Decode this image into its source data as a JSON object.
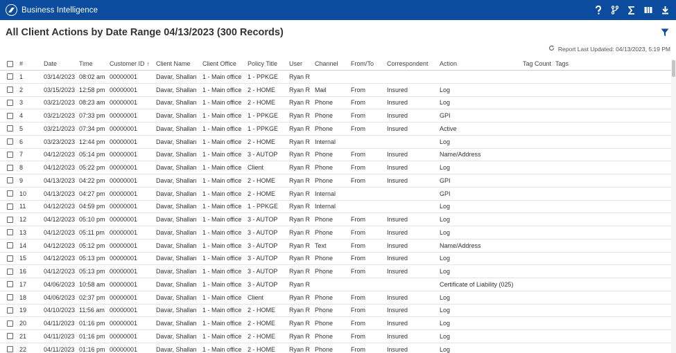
{
  "app": {
    "title": "Business Intelligence"
  },
  "header": {
    "title": "All Client Actions by Date Range 04/13/2023 (300 Records)"
  },
  "report": {
    "last_updated": "Report Last Updated: 04/13/2023, 5:19 PM"
  },
  "columns": [
    "#",
    "Date",
    "Time",
    "Customer ID",
    "Client Name",
    "Client Office",
    "Policy Title",
    "User",
    "Channel",
    "From/To",
    "Correspondent",
    "Action",
    "Tag Count",
    "Tags"
  ],
  "rows": [
    [
      "1",
      "03/14/2023",
      "08:02 am",
      "00000001",
      "Davar, Shallan",
      "1 - Main office",
      "1 - PPKGE",
      "Ryan R",
      "",
      "",
      "",
      "",
      "",
      ""
    ],
    [
      "2",
      "03/15/2023",
      "12:58 pm",
      "00000001",
      "Davar, Shallan",
      "1 - Main office",
      "2 - HOME",
      "Ryan R",
      "Mail",
      "From",
      "Insured",
      "Log",
      "",
      ""
    ],
    [
      "3",
      "03/21/2023",
      "08:23 am",
      "00000001",
      "Davar, Shallan",
      "1 - Main office",
      "2 - HOME",
      "Ryan R",
      "Phone",
      "From",
      "Insured",
      "Log",
      "",
      ""
    ],
    [
      "4",
      "03/21/2023",
      "07:33 pm",
      "00000001",
      "Davar, Shallan",
      "1 - Main office",
      "1 - PPKGE",
      "Ryan R",
      "Phone",
      "From",
      "Insured",
      "GPI",
      "",
      ""
    ],
    [
      "5",
      "03/21/2023",
      "07:34 pm",
      "00000001",
      "Davar, Shallan",
      "1 - Main office",
      "1 - PPKGE",
      "Ryan R",
      "Phone",
      "From",
      "Insured",
      "Active",
      "",
      ""
    ],
    [
      "6",
      "03/23/2023",
      "12:44 pm",
      "00000001",
      "Davar, Shallan",
      "1 - Main office",
      "2 - HOME",
      "Ryan R",
      "Internal",
      "",
      "",
      "Log",
      "",
      ""
    ],
    [
      "7",
      "04/12/2023",
      "05:14 pm",
      "00000001",
      "Davar, Shallan",
      "1 - Main office",
      "3 - AUTOP",
      "Ryan R",
      "Phone",
      "From",
      "Insured",
      "Name/Address",
      "",
      ""
    ],
    [
      "8",
      "04/12/2023",
      "05:22 pm",
      "00000001",
      "Davar, Shallan",
      "1 - Main office",
      "Client",
      "Ryan R",
      "Phone",
      "From",
      "Insured",
      "Log",
      "",
      ""
    ],
    [
      "9",
      "04/13/2023",
      "04:22 pm",
      "00000001",
      "Davar, Shallan",
      "1 - Main office",
      "2 - HOME",
      "Ryan R",
      "Phone",
      "From",
      "Insured",
      "GPI",
      "",
      ""
    ],
    [
      "10",
      "04/13/2023",
      "04:27 pm",
      "00000001",
      "Davar, Shallan",
      "1 - Main office",
      "2 - HOME",
      "Ryan R",
      "Internal",
      "",
      "",
      "GPI",
      "",
      ""
    ],
    [
      "11",
      "04/12/2023",
      "04:59 pm",
      "00000001",
      "Davar, Shallan",
      "1 - Main office",
      "1 - PPKGE",
      "Ryan R",
      "Internal",
      "",
      "",
      "Log",
      "",
      ""
    ],
    [
      "12",
      "04/12/2023",
      "05:10 pm",
      "00000001",
      "Davar, Shallan",
      "1 - Main office",
      "3 - AUTOP",
      "Ryan R",
      "Phone",
      "From",
      "Insured",
      "Log",
      "",
      ""
    ],
    [
      "13",
      "04/12/2023",
      "05:11 pm",
      "00000001",
      "Davar, Shallan",
      "1 - Main office",
      "3 - AUTOP",
      "Ryan R",
      "Phone",
      "From",
      "Insured",
      "Log",
      "",
      ""
    ],
    [
      "14",
      "04/12/2023",
      "05:12 pm",
      "00000001",
      "Davar, Shallan",
      "1 - Main office",
      "3 - AUTOP",
      "Ryan R",
      "Text",
      "From",
      "Insured",
      "Name/Address",
      "",
      ""
    ],
    [
      "15",
      "04/12/2023",
      "05:13 pm",
      "00000001",
      "Davar, Shallan",
      "1 - Main office",
      "3 - AUTOP",
      "Ryan R",
      "Phone",
      "From",
      "Insured",
      "Log",
      "",
      ""
    ],
    [
      "16",
      "04/12/2023",
      "05:13 pm",
      "00000001",
      "Davar, Shallan",
      "1 - Main office",
      "3 - AUTOP",
      "Ryan R",
      "Phone",
      "From",
      "Insured",
      "Log",
      "",
      ""
    ],
    [
      "17",
      "04/06/2023",
      "10:58 am",
      "00000001",
      "Davar, Shallan",
      "1 - Main office",
      "3 - AUTOP",
      "Ryan R",
      "",
      "",
      "",
      "Certificate of Liability (025)",
      "",
      ""
    ],
    [
      "18",
      "04/06/2023",
      "02:37 pm",
      "00000001",
      "Davar, Shallan",
      "1 - Main office",
      "Client",
      "Ryan R",
      "Phone",
      "From",
      "Insured",
      "Log",
      "",
      ""
    ],
    [
      "19",
      "04/10/2023",
      "11:56 am",
      "00000001",
      "Davar, Shallan",
      "1 - Main office",
      "2 - HOME",
      "Ryan R",
      "Phone",
      "From",
      "Insured",
      "Log",
      "",
      ""
    ],
    [
      "20",
      "04/11/2023",
      "01:16 pm",
      "00000001",
      "Davar, Shallan",
      "1 - Main office",
      "2 - HOME",
      "Ryan R",
      "Phone",
      "From",
      "Insured",
      "Log",
      "",
      ""
    ],
    [
      "21",
      "04/11/2023",
      "01:16 pm",
      "00000001",
      "Davar, Shallan",
      "1 - Main office",
      "2 - HOME",
      "Ryan R",
      "Phone",
      "From",
      "Insured",
      "Log",
      "",
      ""
    ],
    [
      "22",
      "04/11/2023",
      "01:16 pm",
      "00000001",
      "Davar, Shallan",
      "1 - Main office",
      "2 - HOME",
      "Ryan R",
      "Phone",
      "From",
      "Insured",
      "Log",
      "",
      ""
    ]
  ],
  "icons": {
    "logo": "logo-icon",
    "help": "help-icon",
    "branch": "branch-icon",
    "sum": "sigma-icon",
    "columns": "columns-icon",
    "download": "download-icon",
    "filter": "filter-icon",
    "refresh": "refresh-icon",
    "sort": "sort-asc-icon"
  },
  "colors": {
    "topbar": "#0b4c9e",
    "accent": "#0b4c9e"
  }
}
